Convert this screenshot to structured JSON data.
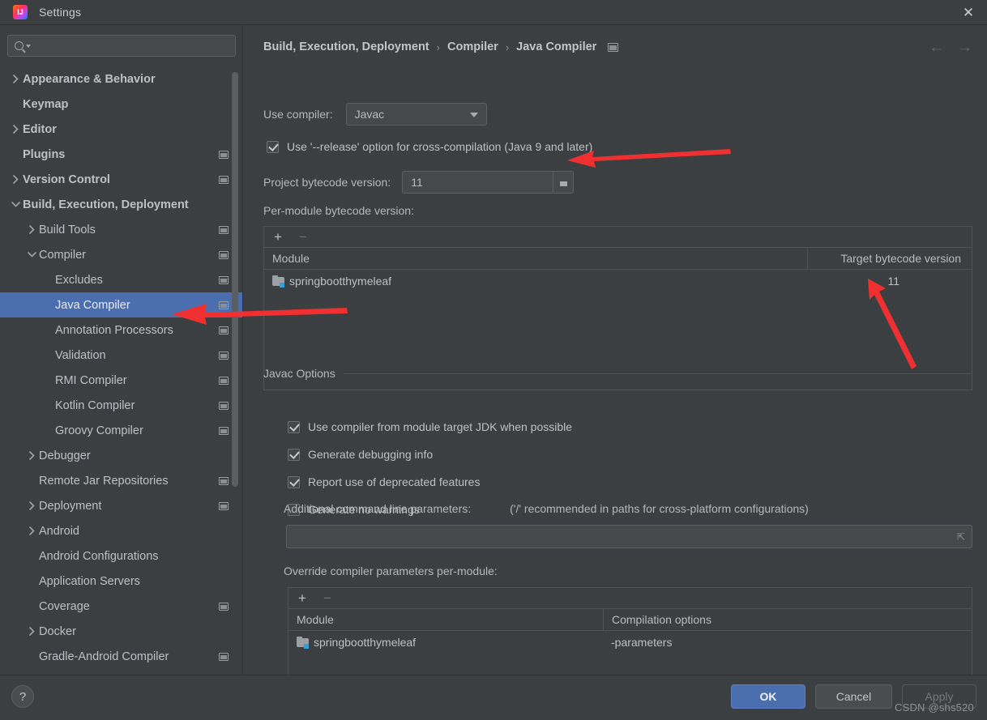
{
  "window": {
    "title": "Settings",
    "logo_icon": "intellij-idea-logo",
    "close_icon": "close-icon"
  },
  "sidebar": {
    "search": {
      "placeholder": "",
      "value": "",
      "icon": "search-icon",
      "caret_icon": "chevron-down-icon"
    },
    "items": [
      {
        "label": "Appearance & Behavior",
        "twisty": "right",
        "top": true,
        "badge": false,
        "indent": 0,
        "selected": false
      },
      {
        "label": "Keymap",
        "twisty": "none",
        "top": true,
        "badge": false,
        "indent": 0,
        "selected": false
      },
      {
        "label": "Editor",
        "twisty": "right",
        "top": true,
        "badge": false,
        "indent": 0,
        "selected": false
      },
      {
        "label": "Plugins",
        "twisty": "none",
        "top": true,
        "badge": true,
        "indent": 0,
        "selected": false
      },
      {
        "label": "Version Control",
        "twisty": "right",
        "top": true,
        "badge": true,
        "indent": 0,
        "selected": false
      },
      {
        "label": "Build, Execution, Deployment",
        "twisty": "down",
        "top": true,
        "badge": false,
        "indent": 0,
        "selected": false
      },
      {
        "label": "Build Tools",
        "twisty": "right",
        "top": false,
        "badge": true,
        "indent": 1,
        "selected": false
      },
      {
        "label": "Compiler",
        "twisty": "down",
        "top": false,
        "badge": true,
        "indent": 1,
        "selected": false
      },
      {
        "label": "Excludes",
        "twisty": "none",
        "top": false,
        "badge": true,
        "indent": 2,
        "selected": false
      },
      {
        "label": "Java Compiler",
        "twisty": "none",
        "top": false,
        "badge": true,
        "indent": 2,
        "selected": true
      },
      {
        "label": "Annotation Processors",
        "twisty": "none",
        "top": false,
        "badge": true,
        "indent": 2,
        "selected": false
      },
      {
        "label": "Validation",
        "twisty": "none",
        "top": false,
        "badge": true,
        "indent": 2,
        "selected": false
      },
      {
        "label": "RMI Compiler",
        "twisty": "none",
        "top": false,
        "badge": true,
        "indent": 2,
        "selected": false
      },
      {
        "label": "Kotlin Compiler",
        "twisty": "none",
        "top": false,
        "badge": true,
        "indent": 2,
        "selected": false
      },
      {
        "label": "Groovy Compiler",
        "twisty": "none",
        "top": false,
        "badge": true,
        "indent": 2,
        "selected": false
      },
      {
        "label": "Debugger",
        "twisty": "right",
        "top": false,
        "badge": false,
        "indent": 1,
        "selected": false
      },
      {
        "label": "Remote Jar Repositories",
        "twisty": "none",
        "top": false,
        "badge": true,
        "indent": 1,
        "selected": false
      },
      {
        "label": "Deployment",
        "twisty": "right",
        "top": false,
        "badge": true,
        "indent": 1,
        "selected": false
      },
      {
        "label": "Android",
        "twisty": "right",
        "top": false,
        "badge": false,
        "indent": 1,
        "selected": false
      },
      {
        "label": "Android Configurations",
        "twisty": "none",
        "top": false,
        "badge": false,
        "indent": 1,
        "selected": false
      },
      {
        "label": "Application Servers",
        "twisty": "none",
        "top": false,
        "badge": false,
        "indent": 1,
        "selected": false
      },
      {
        "label": "Coverage",
        "twisty": "none",
        "top": false,
        "badge": true,
        "indent": 1,
        "selected": false
      },
      {
        "label": "Docker",
        "twisty": "right",
        "top": false,
        "badge": false,
        "indent": 1,
        "selected": false
      },
      {
        "label": "Gradle-Android Compiler",
        "twisty": "none",
        "top": false,
        "badge": true,
        "indent": 1,
        "selected": false
      }
    ]
  },
  "content": {
    "breadcrumb": [
      "Build, Execution, Deployment",
      "Compiler",
      "Java Compiler"
    ],
    "breadcrumb_separator": "›",
    "breadcrumb_badge_icon": "config-scope-icon",
    "nav_back_icon": "arrow-left-icon",
    "nav_forward_icon": "arrow-right-icon",
    "use_compiler": {
      "label": "Use compiler:",
      "value": "Javac",
      "arrow_icon": "chevron-down-icon"
    },
    "release_option": {
      "label": "Use '--release' option for cross-compilation (Java 9 and later)",
      "checked": true
    },
    "project_bytecode": {
      "label": "Project bytecode version:",
      "value": "11",
      "spinner_icon": "chevron-down-icon"
    },
    "per_module_label": "Per-module bytecode version:",
    "per_module_table": {
      "add_icon": "plus-icon",
      "remove_icon": "minus-icon",
      "columns": [
        "Module",
        "Target bytecode version"
      ],
      "rows": [
        {
          "module": "springbootthymeleaf",
          "module_icon": "module-folder-icon",
          "target": "11"
        }
      ]
    },
    "javac_options": {
      "title": "Javac Options",
      "checkboxes": [
        {
          "label": "Use compiler from module target JDK when possible",
          "checked": true
        },
        {
          "label": "Generate debugging info",
          "checked": true
        },
        {
          "label": "Report use of deprecated features",
          "checked": true
        },
        {
          "label": "Generate no warnings",
          "checked": false
        }
      ],
      "additional_params_label": "Additional command line parameters:",
      "additional_params_hint": "('/' recommended in paths for cross-platform configurations)",
      "additional_params_value": "",
      "expand_icon": "expand-icon",
      "override_label": "Override compiler parameters per-module:",
      "override_table": {
        "add_icon": "plus-icon",
        "remove_icon": "minus-icon",
        "columns": [
          "Module",
          "Compilation options"
        ],
        "rows": [
          {
            "module": "springbootthymeleaf",
            "module_icon": "module-folder-icon",
            "options": "-parameters"
          }
        ]
      }
    }
  },
  "footer": {
    "help_label": "?",
    "ok_label": "OK",
    "cancel_label": "Cancel",
    "apply_label": "Apply"
  },
  "watermark": "CSDN @shs520",
  "colors": {
    "background": "#3c3f41",
    "selection": "#4b6eaf",
    "field": "#45494a",
    "text": "#bbbbbb",
    "annotation_red": "#f03030",
    "module_accent": "#389fd6"
  }
}
